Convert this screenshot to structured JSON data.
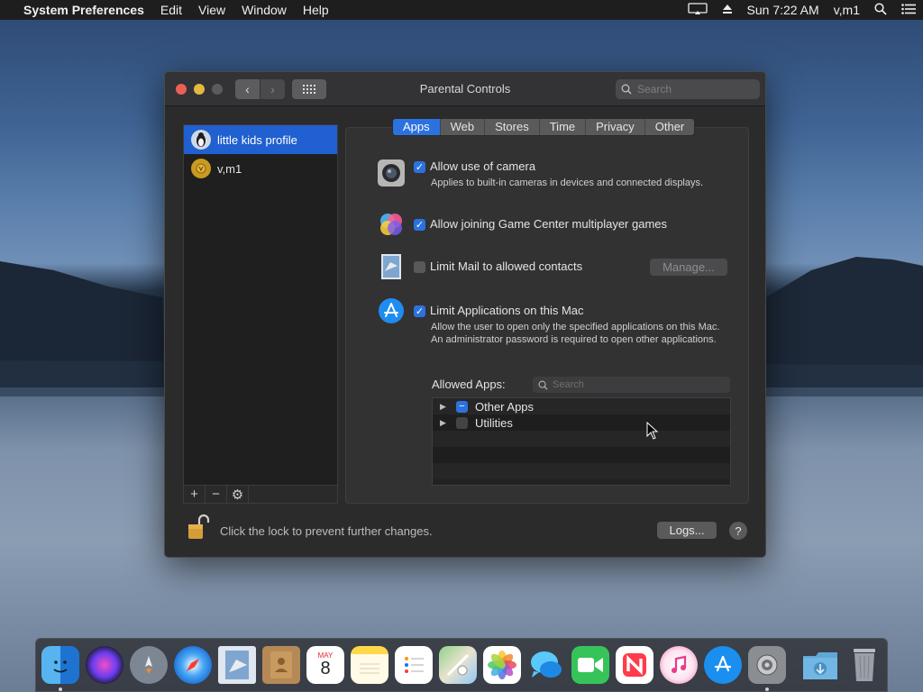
{
  "menubar": {
    "app_name": "System Preferences",
    "items": [
      "Edit",
      "View",
      "Window",
      "Help"
    ],
    "clock": "Sun 7:22 AM",
    "user": "v,m1"
  },
  "window": {
    "title": "Parental Controls",
    "search_placeholder": "Search"
  },
  "users": [
    {
      "name": "little kids profile",
      "selected": true
    },
    {
      "name": "v,m1",
      "selected": false
    }
  ],
  "list_controls": {
    "add": "+",
    "remove": "−",
    "gear": "⚙"
  },
  "tabs": [
    {
      "label": "Apps",
      "active": true
    },
    {
      "label": "Web",
      "active": false
    },
    {
      "label": "Stores",
      "active": false
    },
    {
      "label": "Time",
      "active": false
    },
    {
      "label": "Privacy",
      "active": false
    },
    {
      "label": "Other",
      "active": false
    }
  ],
  "options": {
    "camera": {
      "label": "Allow use of camera",
      "description": "Applies to built-in cameras in devices and connected displays.",
      "checked": true
    },
    "game_center": {
      "label": "Allow joining Game Center multiplayer games",
      "checked": true
    },
    "mail": {
      "label": "Limit Mail to allowed contacts",
      "checked": false,
      "button": "Manage..."
    },
    "apps": {
      "label": "Limit Applications on this Mac",
      "description": "Allow the user to open only the specified applications on this Mac. An administrator password is required to open other applications.",
      "checked": true
    }
  },
  "allowed_apps": {
    "label": "Allowed Apps:",
    "search_placeholder": "Search",
    "items": [
      {
        "name": "Other Apps",
        "state": "mixed"
      },
      {
        "name": "Utilities",
        "state": "off"
      }
    ]
  },
  "footer": {
    "lock_text": "Click the lock to prevent further changes.",
    "logs_button": "Logs...",
    "help": "?"
  },
  "dock": {
    "apps": [
      "finder",
      "siri",
      "launchpad",
      "safari",
      "mail",
      "contacts",
      "calendar",
      "notes",
      "reminders",
      "maps",
      "photos",
      "messages",
      "facetime",
      "news",
      "itunes",
      "app-store",
      "system-preferences"
    ],
    "calendar_month": "MAY",
    "calendar_day": "8"
  },
  "colors": {
    "accent": "#2b72e0",
    "selection": "#2060d0"
  }
}
